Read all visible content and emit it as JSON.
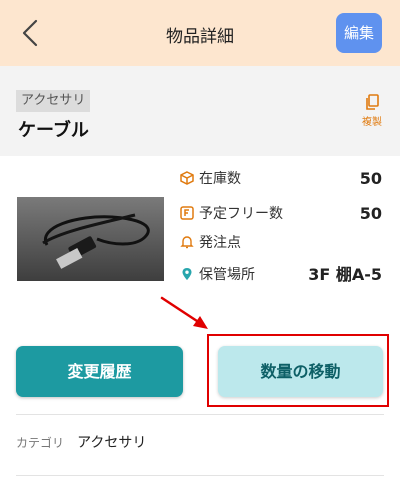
{
  "header": {
    "title": "物品詳細",
    "edit_label": "編集"
  },
  "item": {
    "category_tag": "アクセサリ",
    "name": "ケーブル",
    "copy_label": "複製"
  },
  "stats": [
    {
      "label": "在庫数",
      "value": "50",
      "icon": "box-icon"
    },
    {
      "label": "予定フリー数",
      "value": "50",
      "icon": "f-badge-icon"
    },
    {
      "label": "発注点",
      "value": "",
      "icon": "bell-icon"
    },
    {
      "label": "保管場所",
      "value": "3F 棚A-5",
      "icon": "location-pin-icon"
    }
  ],
  "actions": {
    "history_label": "変更履歴",
    "move_label": "数量の移動"
  },
  "details": {
    "category_label": "カテゴリ",
    "category_value": "アクセサリ"
  },
  "colors": {
    "accent_orange": "#e07b10",
    "teal": "#1d9aa1",
    "light_teal": "#bce8ec",
    "edit_blue": "#5f92ef",
    "highlight_red": "#e00000",
    "header_bg": "#fde6cf"
  }
}
